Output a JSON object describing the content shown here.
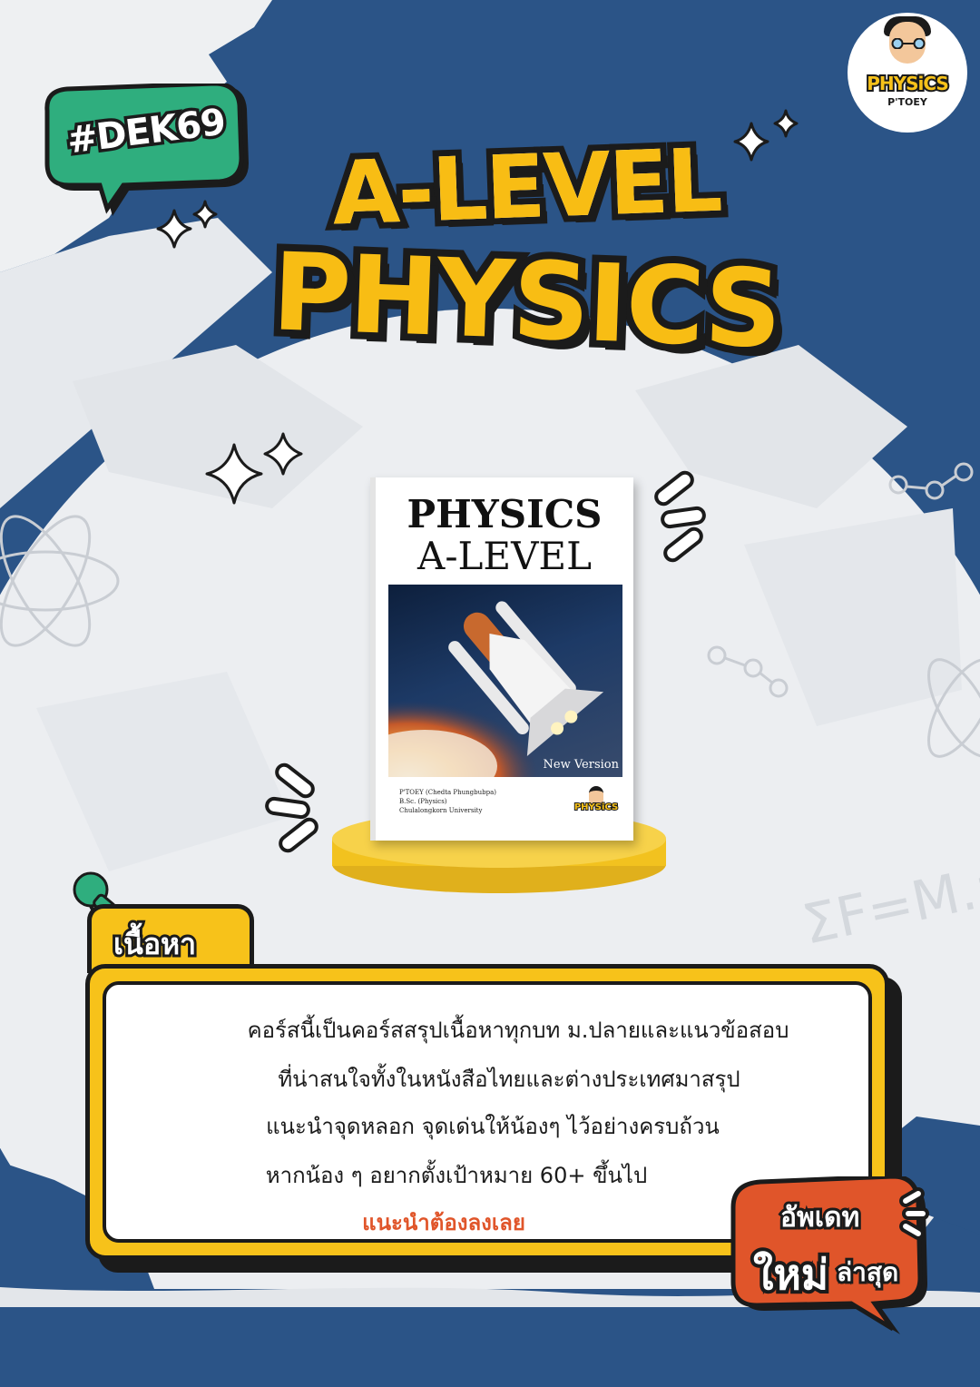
{
  "badge": {
    "tag": "#DEK69"
  },
  "headline": {
    "line1": "A-LEVEL",
    "line2": "PHYSICS"
  },
  "logo": {
    "brand": "PHYSiCS",
    "sub": "P'TOEY"
  },
  "book": {
    "title_line1": "PHYSICS",
    "title_line2": "A-LEVEL",
    "version": "New Version",
    "author_lines": [
      "P'TOEY (Chedta Phungbubpa)",
      "B.Sc. (Physics)",
      "Chulalongkorn University"
    ],
    "logo_text": "PHYSiCS"
  },
  "section": {
    "tab_label": "เนื้อหา",
    "lines": [
      "คอร์สนี้เป็นคอร์สสรุปเนื้อหาทุกบท ม.ปลายและแนวข้อสอบ",
      "ที่น่าสนใจทั้งในหนังสือไทยและต่างประเทศมาสรุป",
      "แนะนำจุดหลอก จุดเด่นให้น้องๆ ไว้อย่างครบถ้วน",
      "หากน้อง ๆ อยากตั้งเป้าหมาย 60+ ขึ้นไป"
    ],
    "highlight": "แนะนำต้องลงเลย"
  },
  "update_bubble": {
    "line1": "อัพเดท",
    "line2_big": "ใหม่",
    "line2_small": "ล่าสุด"
  },
  "colors": {
    "navy": "#2b5487",
    "yellow": "#f7c21a",
    "green": "#2fae7e",
    "red": "#e0552a",
    "ink": "#1b1b1b"
  }
}
